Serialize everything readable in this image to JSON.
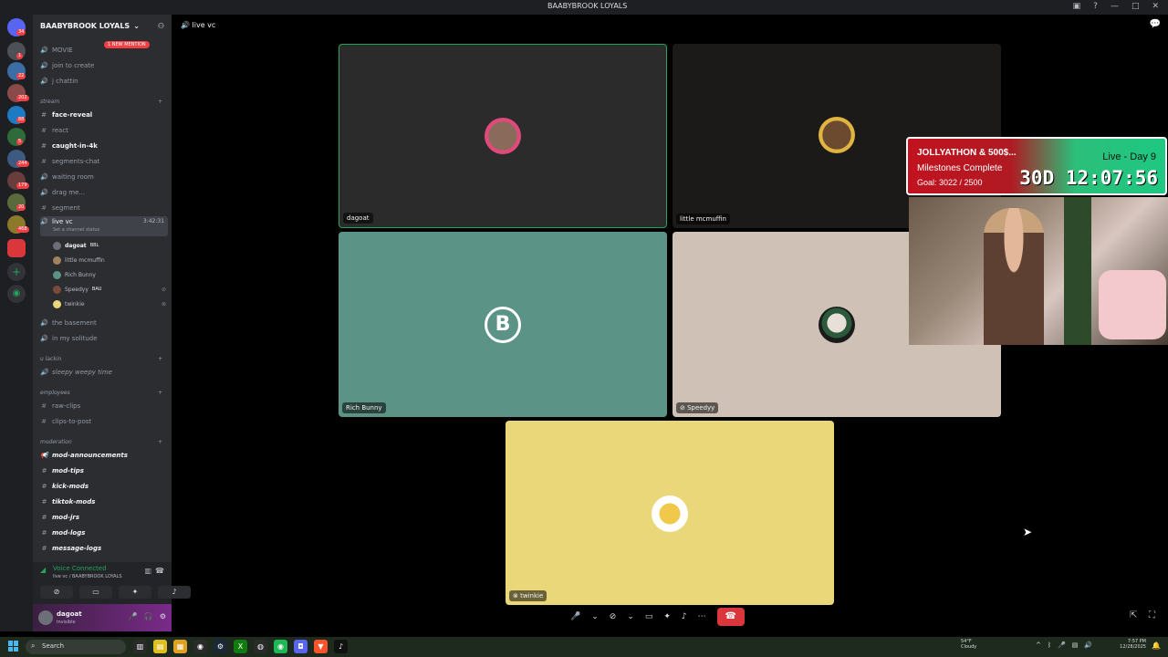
{
  "window": {
    "title": "BAABYBROOK LOYALS"
  },
  "server": {
    "name": "BAABYBROOK LOYALS",
    "mention_pill": "1 NEW MENTION",
    "channels_top": [
      {
        "name": "MOVIE"
      },
      {
        "name": "join to create"
      },
      {
        "name": "j chattin"
      }
    ],
    "categories": {
      "stream": "stream",
      "u_lackin": "u lackin",
      "employees": "employees",
      "moderation": "moderation"
    },
    "stream_channels": [
      {
        "name": "face-reveal"
      },
      {
        "name": "react"
      },
      {
        "name": "caught-in-4k"
      },
      {
        "name": "segments-chat"
      },
      {
        "name": "waiting room"
      },
      {
        "name": "drag me..."
      },
      {
        "name": "segment"
      },
      {
        "name": "live vc",
        "timer": "3:42:31",
        "status": "Set a channel status"
      }
    ],
    "voice_users": [
      {
        "name": "dagoat",
        "tag": "BBL"
      },
      {
        "name": "little mcmuffin",
        "tag": ""
      },
      {
        "name": "Rich Bunny",
        "tag": ""
      },
      {
        "name": "Speedyy",
        "tag": "BAU"
      },
      {
        "name": "twinkie",
        "tag": ""
      }
    ],
    "more_channels": [
      {
        "name": "the basement"
      },
      {
        "name": "in my solitude"
      }
    ],
    "lackin_channels": [
      {
        "name": "sleepy weepy time"
      }
    ],
    "employee_channels": [
      {
        "name": "raw-clips"
      },
      {
        "name": "clips-to-post"
      }
    ],
    "mod_channels": [
      {
        "name": "mod-announcements"
      },
      {
        "name": "mod-tips"
      },
      {
        "name": "kick-mods"
      },
      {
        "name": "tiktok-mods"
      },
      {
        "name": "mod-jrs"
      },
      {
        "name": "mod-logs"
      },
      {
        "name": "message-logs"
      }
    ]
  },
  "voice_panel": {
    "title": "Voice Connected",
    "subtitle": "live vc / BAABYBROOK LOYALS"
  },
  "user": {
    "name": "dagoat",
    "status": "Invisible"
  },
  "topbar": {
    "channel": "live vc"
  },
  "tiles": [
    {
      "name": "dagoat"
    },
    {
      "name": "little mcmuffin"
    },
    {
      "name": "Rich Bunny"
    },
    {
      "name": "Speedyy"
    },
    {
      "name": "twinkie"
    }
  ],
  "overlay": {
    "line1": "JOLLYATHON & 500$...",
    "line2": "Milestones Complete",
    "line3": "Goal: 3022 / 2500",
    "live": "Live - Day 9",
    "timer": "30D 12:07:56"
  },
  "rail_badges": [
    "34",
    "1",
    "22",
    "202",
    "88",
    "5",
    "244",
    "179",
    "20",
    "468"
  ],
  "taskbar": {
    "search_placeholder": "Search",
    "weather_temp": "54°F",
    "weather_desc": "Cloudy",
    "time": "7:57 PM",
    "date": "12/28/2025"
  },
  "colors": {
    "accent": "#23a55a",
    "danger": "#da373c",
    "tile_green": "#5b9486",
    "tile_beige": "#cfc1b6",
    "tile_yellow": "#ead77a"
  }
}
